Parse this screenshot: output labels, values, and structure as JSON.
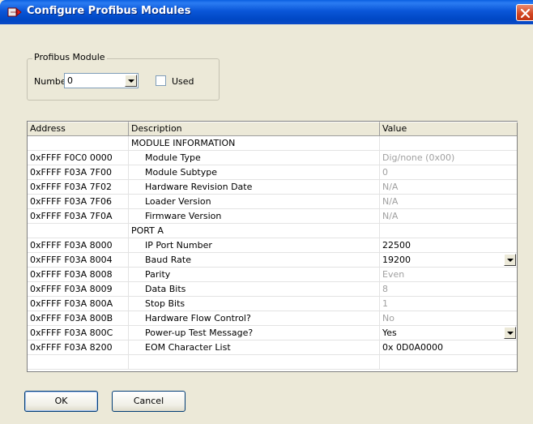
{
  "window": {
    "title": "Configure Profibus Modules"
  },
  "module_group": {
    "legend": "Profibus Module",
    "number_label": "Number:",
    "number_value": "0",
    "used_label": "Used",
    "used_checked": false
  },
  "grid": {
    "columns": [
      "Address",
      "Description",
      "Value"
    ],
    "rows": [
      {
        "type": "section",
        "address": "",
        "description": "MODULE INFORMATION",
        "value": "",
        "value_state": "disabled",
        "dropdown": false
      },
      {
        "type": "item",
        "address": "0xFFFF F0C0 0000",
        "description": "Module Type",
        "value": "Dig/none (0x00)",
        "value_state": "disabled",
        "dropdown": false
      },
      {
        "type": "item",
        "address": "0xFFFF F03A 7F00",
        "description": "Module Subtype",
        "value": "0",
        "value_state": "disabled",
        "dropdown": false
      },
      {
        "type": "item",
        "address": "0xFFFF F03A 7F02",
        "description": "Hardware Revision Date",
        "value": "N/A",
        "value_state": "disabled",
        "dropdown": false
      },
      {
        "type": "item",
        "address": "0xFFFF F03A 7F06",
        "description": "Loader Version",
        "value": "N/A",
        "value_state": "disabled",
        "dropdown": false
      },
      {
        "type": "item",
        "address": "0xFFFF F03A 7F0A",
        "description": "Firmware Version",
        "value": "N/A",
        "value_state": "disabled",
        "dropdown": false
      },
      {
        "type": "section",
        "address": "",
        "description": "PORT A",
        "value": "",
        "value_state": "disabled",
        "dropdown": false
      },
      {
        "type": "item",
        "address": "0xFFFF F03A 8000",
        "description": "IP Port Number",
        "value": "22500",
        "value_state": "enabled",
        "dropdown": false
      },
      {
        "type": "item",
        "address": "0xFFFF F03A 8004",
        "description": "Baud Rate",
        "value": "19200",
        "value_state": "enabled",
        "dropdown": true
      },
      {
        "type": "item",
        "address": "0xFFFF F03A 8008",
        "description": "Parity",
        "value": "Even",
        "value_state": "disabled",
        "dropdown": false
      },
      {
        "type": "item",
        "address": "0xFFFF F03A 8009",
        "description": "Data Bits",
        "value": "8",
        "value_state": "disabled",
        "dropdown": false
      },
      {
        "type": "item",
        "address": "0xFFFF F03A 800A",
        "description": "Stop Bits",
        "value": "1",
        "value_state": "disabled",
        "dropdown": false
      },
      {
        "type": "item",
        "address": "0xFFFF F03A 800B",
        "description": "Hardware Flow Control?",
        "value": "No",
        "value_state": "disabled",
        "dropdown": false
      },
      {
        "type": "item",
        "address": "0xFFFF F03A 800C",
        "description": "Power-up Test Message?",
        "value": "Yes",
        "value_state": "enabled",
        "dropdown": true
      },
      {
        "type": "item",
        "address": "0xFFFF F03A 8200",
        "description": "EOM Character List",
        "value": "0x 0D0A0000",
        "value_state": "enabled",
        "dropdown": false
      },
      {
        "type": "blank",
        "address": "",
        "description": "",
        "value": "",
        "value_state": "enabled",
        "dropdown": false
      }
    ]
  },
  "buttons": {
    "ok": "OK",
    "cancel": "Cancel"
  },
  "icons": {
    "title": "arrow-module-icon",
    "close": "close-icon",
    "dropdown": "chevron-down-icon"
  },
  "colors": {
    "titlebar": "#0a56d8",
    "dialog_bg": "#ece9d8",
    "close": "#d1441f",
    "disabled_text": "#a0a0a0"
  }
}
